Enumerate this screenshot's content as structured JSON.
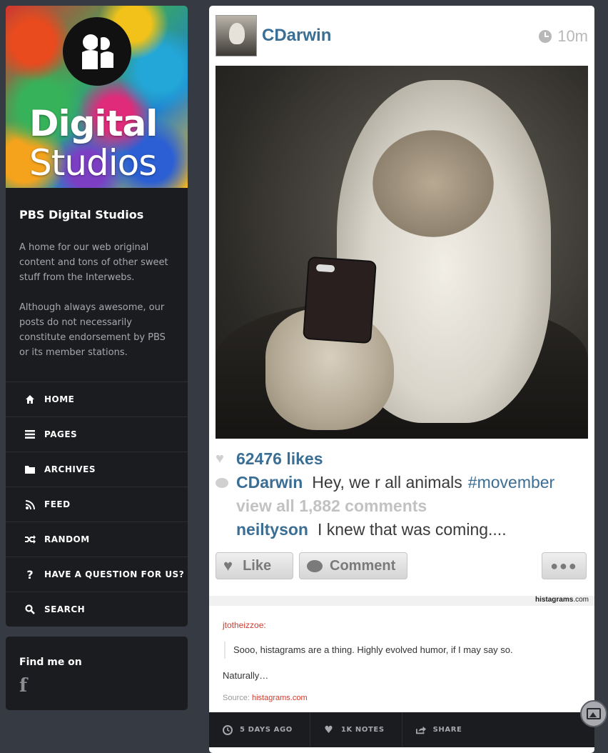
{
  "sidebar": {
    "header_lines": [
      "Digital",
      "Studios"
    ],
    "blog_title": "PBS Digital Studios",
    "description": [
      "A home for our web original content and tons of other sweet stuff from the Interwebs.",
      "Although always awesome, our posts do not necessarily constitute endorsement by PBS or its member stations."
    ],
    "nav": [
      {
        "label": "HOME",
        "icon": "home-icon"
      },
      {
        "label": "PAGES",
        "icon": "list-icon"
      },
      {
        "label": "ARCHIVES",
        "icon": "folder-icon"
      },
      {
        "label": "FEED",
        "icon": "rss-icon"
      },
      {
        "label": "RANDOM",
        "icon": "shuffle-icon"
      },
      {
        "label": "HAVE A QUESTION FOR US?",
        "icon": "question-icon"
      },
      {
        "label": "SEARCH",
        "icon": "search-icon"
      }
    ],
    "find_me": {
      "title": "Find me on",
      "icon": "facebook-icon",
      "glyph": "f"
    }
  },
  "post": {
    "insta": {
      "username": "CDarwin",
      "time": "10m",
      "likes": "62476 likes",
      "caption_user": "CDarwin",
      "caption_text": "Hey, we r all animals",
      "hashtag": "#movember",
      "view_all": "view all 1,882 comments",
      "reply_user": "neiltyson",
      "reply_text": "I knew that was coming....",
      "like_button": "Like",
      "comment_button": "Comment",
      "more_button": "●●●",
      "credit_bold": "histagrams",
      "credit_suffix": ".com"
    },
    "caption": {
      "user": "jtotheizzoe",
      "user_suffix": ":",
      "quote": "Sooo, histagrams are a thing. Highly evolved humor, if I may say so.",
      "line": "Naturally…",
      "source_label": "Source:",
      "source_link": "histagrams.com"
    },
    "footer": {
      "time": "5 DAYS AGO",
      "notes": "1K NOTES",
      "share": "SHARE"
    }
  },
  "colors": {
    "background": "#363a43",
    "panel": "#1b1c20",
    "insta_blue": "#3b6e94",
    "link_red": "#d33a2c"
  }
}
